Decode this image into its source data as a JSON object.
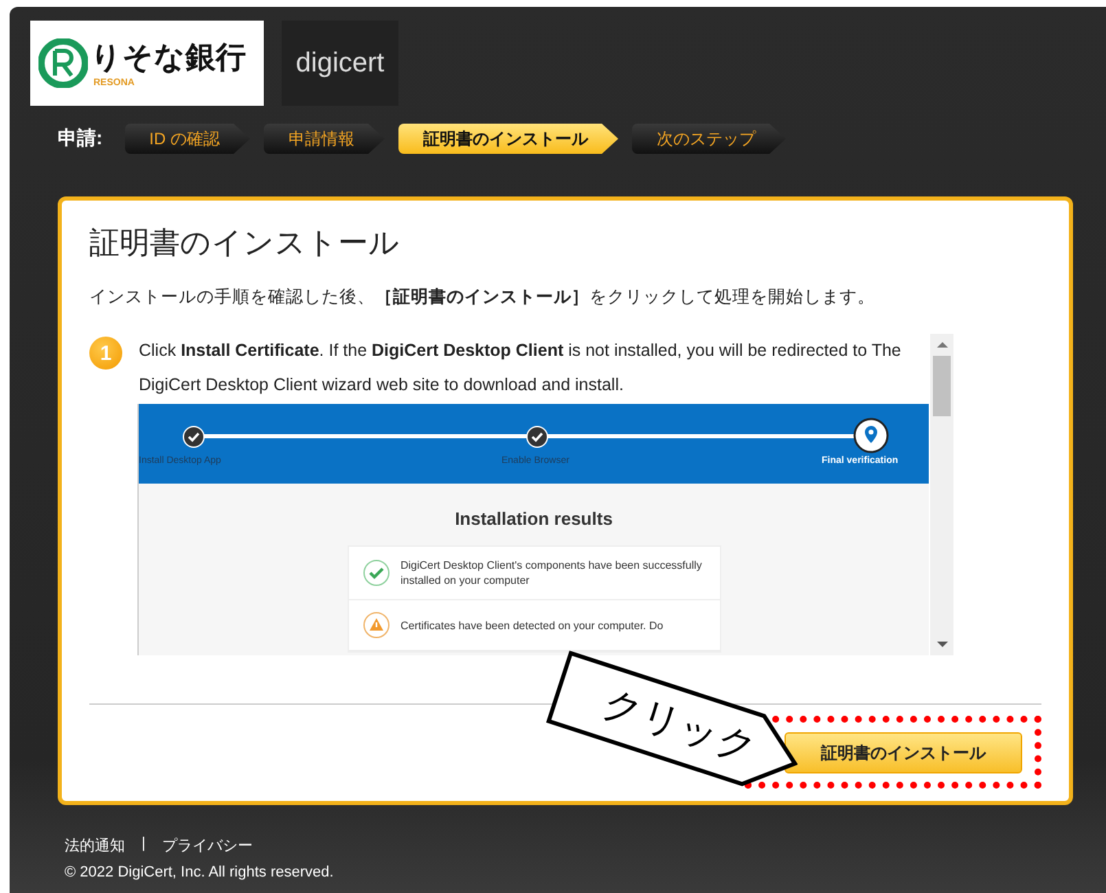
{
  "header": {
    "bank_logo": "りそな銀行",
    "bank_logo_sub": "RESONA",
    "partner_logo": "digicert"
  },
  "steps": {
    "label": "申請:",
    "items": [
      {
        "label": "ID の確認",
        "selected": false
      },
      {
        "label": "申請情報",
        "selected": false
      },
      {
        "label": "証明書のインストール",
        "selected": true
      },
      {
        "label": "次のステップ",
        "selected": false
      }
    ]
  },
  "card": {
    "title": "証明書のインストール",
    "instruction": "インストールの手順を確認した後、**［証明書のインストール］**をクリックして処理を開始します。",
    "step_number": "1",
    "step_text": "Click **Install Certificate**. If the **DigiCert Desktop Client** is not installed, you will be redirected to The DigiCert Desktop Client wizard web site to download and install.",
    "wizard": {
      "stages": [
        {
          "label": "Install Desktop App",
          "selected": false
        },
        {
          "label": "Enable Browser",
          "selected": false
        },
        {
          "label": "Final verification",
          "selected": true
        }
      ],
      "heading": "Installation results",
      "results": [
        {
          "kind": "success",
          "text": "DigiCert Desktop Client's components have been successfully installed on your computer"
        },
        {
          "kind": "warning",
          "text": "Certificates have been detected on your computer. Do"
        }
      ]
    },
    "button": "証明書のインストール",
    "callout": "クリック"
  },
  "footer": {
    "links": [
      "法的通知",
      "プライバシー"
    ],
    "separator": "|",
    "copyright": "© 2022 DigiCert, Inc. All rights reserved."
  }
}
